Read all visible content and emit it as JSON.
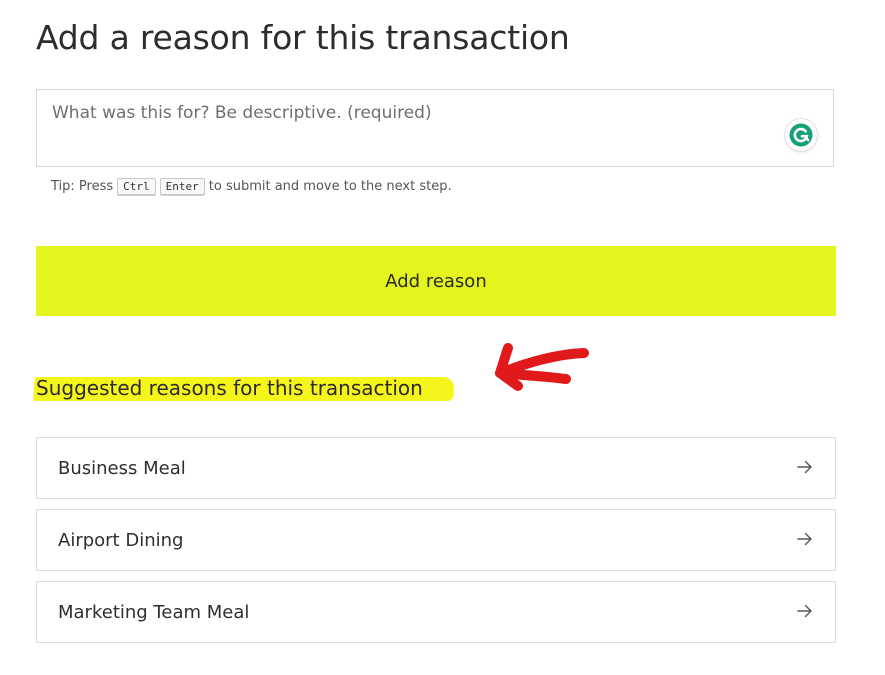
{
  "page": {
    "title": "Add a reason for this transaction"
  },
  "reason_input": {
    "placeholder": "What was this for? Be descriptive. (required)",
    "value": ""
  },
  "tip": {
    "prefix": "Tip: Press",
    "key1": "Ctrl",
    "key2": "Enter",
    "suffix": "to submit and move to the next step."
  },
  "add_button": {
    "label": "Add reason",
    "color": "#e3f41e"
  },
  "suggestions": {
    "heading": "Suggested reasons for this transaction",
    "highlight_color": "#f6f51b",
    "annotation_color": "#e0191b",
    "items": [
      {
        "label": "Business Meal",
        "icon": "arrow-right-icon"
      },
      {
        "label": "Airport Dining",
        "icon": "arrow-right-icon"
      },
      {
        "label": "Marketing Team Meal",
        "icon": "arrow-right-icon"
      }
    ]
  },
  "extension": {
    "icon": "grammarly-icon"
  }
}
